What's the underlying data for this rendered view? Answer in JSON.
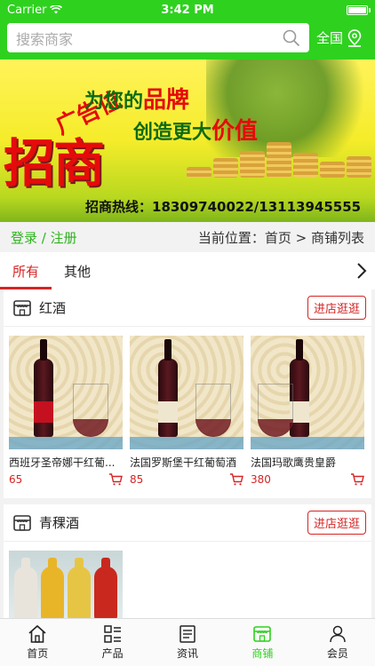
{
  "status": {
    "carrier": "Carrier",
    "time": "3:42 PM"
  },
  "header": {
    "search_placeholder": "搜索商家",
    "region": "全国"
  },
  "banner": {
    "ad_small": "广告位",
    "ad_big": "招商",
    "slogan1_pre": "为您的",
    "slogan1_em": "品牌",
    "slogan2_pre": "创造更大",
    "slogan2_em": "价值",
    "hotline": "招商热线：18309740022/13113945555"
  },
  "crumb": {
    "login": "登录 / 注册",
    "location": "当前位置：首页 > 商铺列表"
  },
  "tabs": [
    {
      "label": "所有",
      "active": true
    },
    {
      "label": "其他",
      "active": false
    }
  ],
  "shops": [
    {
      "name": "红酒",
      "enter_label": "进店逛逛",
      "products": [
        {
          "name": "西班牙圣帝娜干红葡...",
          "price": "65"
        },
        {
          "name": "法国罗斯堡干红葡萄酒",
          "price": "85"
        },
        {
          "name": "法国玛歌鹰贵皇爵",
          "price": "380"
        }
      ]
    },
    {
      "name": "青稞酒",
      "enter_label": "进店逛逛",
      "products": []
    }
  ],
  "tabbar": [
    {
      "label": "首页",
      "icon": "home-icon"
    },
    {
      "label": "产品",
      "icon": "grid-list-icon"
    },
    {
      "label": "资讯",
      "icon": "news-icon"
    },
    {
      "label": "商铺",
      "icon": "shop-icon",
      "active": true
    },
    {
      "label": "会员",
      "icon": "user-icon"
    }
  ],
  "colors": {
    "brand_green": "#2fd11f",
    "accent_red": "#d62424"
  }
}
